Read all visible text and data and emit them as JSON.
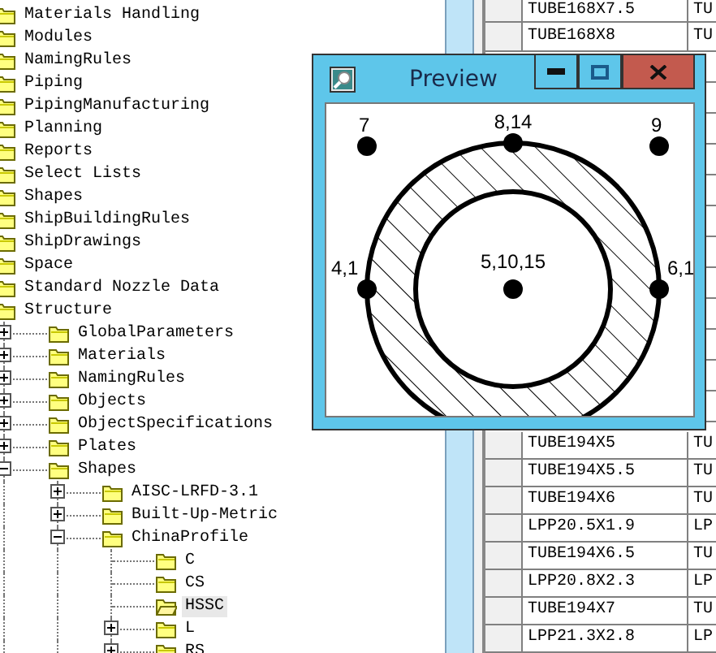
{
  "tree": {
    "items": [
      {
        "label": "Materials Handling"
      },
      {
        "label": "Modules"
      },
      {
        "label": "NamingRules"
      },
      {
        "label": "Piping"
      },
      {
        "label": "PipingManufacturing"
      },
      {
        "label": "Planning"
      },
      {
        "label": "Reports"
      },
      {
        "label": "Select Lists"
      },
      {
        "label": "Shapes"
      },
      {
        "label": "ShipBuildingRules"
      },
      {
        "label": "ShipDrawings"
      },
      {
        "label": "Space"
      },
      {
        "label": "Standard Nozzle Data"
      },
      {
        "label": "Structure",
        "children": [
          {
            "label": "GlobalParameters",
            "expanded": false
          },
          {
            "label": "Materials",
            "expanded": false
          },
          {
            "label": "NamingRules",
            "expanded": false
          },
          {
            "label": "Objects",
            "expanded": false
          },
          {
            "label": "ObjectSpecifications",
            "expanded": false
          },
          {
            "label": "Plates",
            "expanded": false
          },
          {
            "label": "Shapes",
            "expanded": true,
            "children": [
              {
                "label": "AISC-LRFD-3.1",
                "expanded": false
              },
              {
                "label": "Built-Up-Metric",
                "expanded": false
              },
              {
                "label": "ChinaProfile",
                "expanded": true,
                "children": [
                  {
                    "label": "C",
                    "selected": false
                  },
                  {
                    "label": "CS",
                    "selected": false
                  },
                  {
                    "label": "HSSC",
                    "selected": true
                  },
                  {
                    "label": "L",
                    "selected": false,
                    "expanded": false
                  },
                  {
                    "label": "RS",
                    "selected": false,
                    "expanded": false
                  }
                ]
              }
            ]
          }
        ]
      }
    ]
  },
  "grid": {
    "rows_above": [
      {
        "column_1": "TUBE168X7.5",
        "column_2": "TU"
      },
      {
        "column_1": "TUBE168X8",
        "column_2": "TU"
      }
    ],
    "rows_below": [
      {
        "column_1": "TUBE194X5",
        "column_2": "TU"
      },
      {
        "column_1": "TUBE194X5.5",
        "column_2": "TU"
      },
      {
        "column_1": "TUBE194X6",
        "column_2": "TU"
      },
      {
        "column_1": "LPP20.5X1.9",
        "column_2": "LP"
      },
      {
        "column_1": "TUBE194X6.5",
        "column_2": "TU"
      },
      {
        "column_1": "LPP20.8X2.3",
        "column_2": "LP"
      },
      {
        "column_1": "TUBE194X7",
        "column_2": "TU"
      },
      {
        "column_1": "LPP21.3X2.8",
        "column_2": "LP"
      }
    ]
  },
  "preview": {
    "title": "Preview",
    "points": [
      {
        "label": "7"
      },
      {
        "label": "8,14"
      },
      {
        "label": "9"
      },
      {
        "label": "4,1"
      },
      {
        "label": "5,10,15"
      },
      {
        "label": "6,1"
      }
    ]
  }
}
